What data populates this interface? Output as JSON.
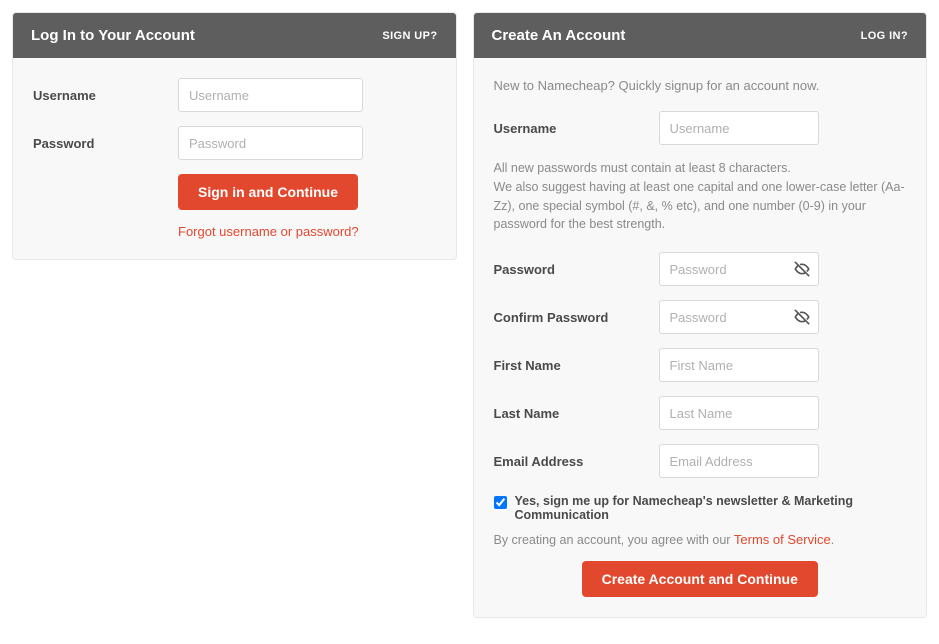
{
  "login": {
    "title": "Log In to Your Account",
    "header_link": "SIGN UP?",
    "username_label": "Username",
    "username_placeholder": "Username",
    "password_label": "Password",
    "password_placeholder": "Password",
    "submit_label": "Sign in and Continue",
    "forgot_label": "Forgot username or password?"
  },
  "signup": {
    "title": "Create An Account",
    "header_link": "LOG IN?",
    "intro": "New to Namecheap? Quickly signup for an account now.",
    "username_label": "Username",
    "username_placeholder": "Username",
    "password_help": "All new passwords must contain at least 8 characters.\nWe also suggest having at least one capital and one lower-case letter (Aa-Zz), one special symbol (#, &, % etc), and one number (0-9) in your password for the best strength.",
    "password_label": "Password",
    "password_placeholder": "Password",
    "confirm_label": "Confirm Password",
    "confirm_placeholder": "Password",
    "firstname_label": "First Name",
    "firstname_placeholder": "First Name",
    "lastname_label": "Last Name",
    "lastname_placeholder": "Last Name",
    "email_label": "Email Address",
    "email_placeholder": "Email Address",
    "newsletter_label": "Yes, sign me up for Namecheap's newsletter & Marketing Communication",
    "tos_prefix": "By creating an account, you agree with our ",
    "tos_link": "Terms of Service",
    "tos_suffix": ".",
    "submit_label": "Create Account and Continue"
  }
}
